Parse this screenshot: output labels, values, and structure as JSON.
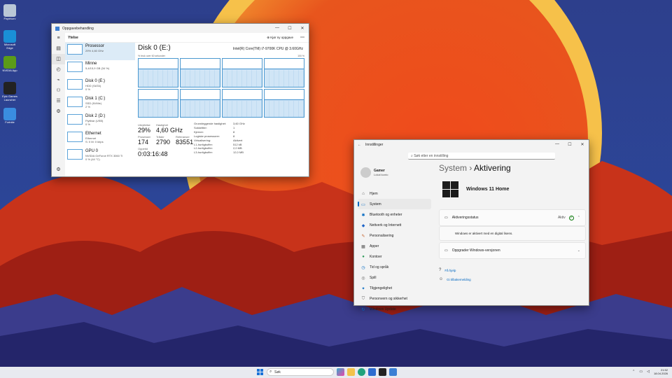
{
  "desktop": {
    "icons": [
      {
        "label": "Papirkurv",
        "color": "#b9c7d6",
        "icon": "recycle-bin-icon"
      },
      {
        "label": "Microsoft Edge",
        "color": "#1a8fd6",
        "icon": "edge-icon"
      },
      {
        "label": "NVIDIA App",
        "color": "#5b9b19",
        "icon": "nvidia-icon"
      },
      {
        "label": "Epic Games Launcher",
        "color": "#222222",
        "icon": "epic-icon"
      },
      {
        "label": "Fortnite",
        "color": "#3a8de0",
        "icon": "fortnite-icon"
      }
    ]
  },
  "taskmgr": {
    "title": "Oppgavebehandling",
    "header": "Ytelse",
    "run_task": "Kjør ny oppgave",
    "items": [
      {
        "name": "Prosessor",
        "sub1": "29% 4,60 GHz",
        "sub2": ""
      },
      {
        "name": "Minne",
        "sub1": "5,4/15,9 GB (34 %)",
        "sub2": ""
      },
      {
        "name": "Disk 0 (E:)",
        "sub1": "HDD (SATA)",
        "sub2": "0 %"
      },
      {
        "name": "Disk 1 (C:)",
        "sub1": "SSD (NVMe)",
        "sub2": "2 %"
      },
      {
        "name": "Disk 2 (D:)",
        "sub1": "Flyttbar (USB)",
        "sub2": "0 %"
      },
      {
        "name": "Ethernet",
        "sub1": "Ethernet",
        "sub2": "S: 0 M: 0 kbps"
      },
      {
        "name": "GPU 0",
        "sub1": "NVIDIA GeForce RTX 3060 Ti",
        "sub2": "0 % (44 °C)"
      }
    ],
    "detail": {
      "title": "Disk 0 (E:)",
      "cpu": "Intel(R) Core(TM) i7-9700K CPU @ 3.60GHz",
      "sub_left": "% bruk over 60 sekunder",
      "sub_right": "100 %",
      "util_label": "Utnyttelse",
      "util": "29%",
      "speed_label": "Hastighet",
      "speed": "4,60 GHz",
      "proc_label": "Prosesser",
      "proc": "174",
      "threads_label": "Tråder",
      "threads": "2790",
      "handles_label": "Referanser",
      "handles": "83551",
      "uptime_label": "Oppetid",
      "uptime": "0:03:16:48",
      "kv": [
        [
          "Grunnleggende hastighet:",
          "3,60 GHz"
        ],
        [
          "Sokkeltter:",
          "1"
        ],
        [
          "Kjerner:",
          "8"
        ],
        [
          "Logiske prosessorer:",
          "8"
        ],
        [
          "Virtualisering:",
          "Aktivert"
        ],
        [
          "L1-hurtigbuffer:",
          "512 kB"
        ],
        [
          "L2-hurtigbuffer:",
          "2,0 MB"
        ],
        [
          "L3-hurtigbuffer:",
          "12,0 MB"
        ]
      ]
    }
  },
  "settings": {
    "title": "Innstillinger",
    "search_placeholder": "Søk etter en innstilling",
    "user_name": "Gamer",
    "user_sub": "Lokal konto",
    "nav": [
      {
        "label": "Hjem",
        "icon": "home-icon",
        "glyph": "⌂",
        "color": "#555"
      },
      {
        "label": "System",
        "icon": "system-icon",
        "glyph": "▭",
        "color": "#0067c0"
      },
      {
        "label": "Bluetooth og enheter",
        "icon": "bluetooth-icon",
        "glyph": "✱",
        "color": "#0067c0"
      },
      {
        "label": "Nettverk og Internett",
        "icon": "network-icon",
        "glyph": "◆",
        "color": "#1e64c8"
      },
      {
        "label": "Personalisering",
        "icon": "brush-icon",
        "glyph": "✎",
        "color": "#c4632d"
      },
      {
        "label": "Apper",
        "icon": "apps-icon",
        "glyph": "▦",
        "color": "#555"
      },
      {
        "label": "Kontoer",
        "icon": "accounts-icon",
        "glyph": "●",
        "color": "#2e9a5a"
      },
      {
        "label": "Tid og språk",
        "icon": "time-icon",
        "glyph": "◷",
        "color": "#0067c0"
      },
      {
        "label": "Spill",
        "icon": "gaming-icon",
        "glyph": "◎",
        "color": "#666"
      },
      {
        "label": "Tilgjengelighet",
        "icon": "accessibility-icon",
        "glyph": "✦",
        "color": "#0067c0"
      },
      {
        "label": "Personvern og sikkerhet",
        "icon": "shield-icon",
        "glyph": "⛉",
        "color": "#666"
      },
      {
        "label": "Windows Update",
        "icon": "update-icon",
        "glyph": "↻",
        "color": "#0067c0"
      }
    ],
    "crumb_parent": "System",
    "crumb_sep": "›",
    "crumb_current": "Aktivering",
    "edition": "Windows 11 Home",
    "activation_label": "Aktiveringsstatus",
    "activation_state": "Aktiv",
    "activation_msg": "Windows er aktivert med en digital lisens.",
    "upgrade_label": "Oppgrader Windows-versjonen",
    "help": "Få hjelp",
    "feedback": "Gi tilbakemelding"
  },
  "taskbar": {
    "search": "Søk",
    "time": "21:52",
    "date": "18.04.2026"
  }
}
